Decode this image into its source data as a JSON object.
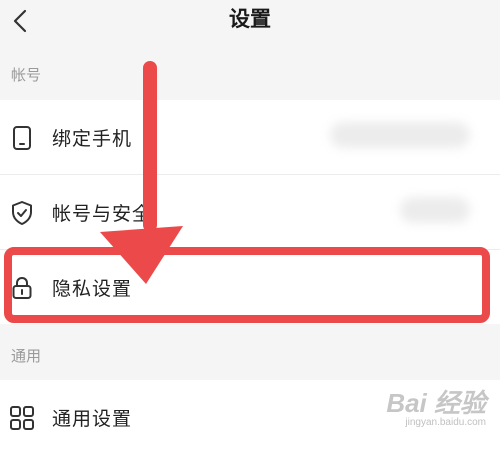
{
  "header": {
    "title": "设置",
    "back_icon": "chevron-left-icon"
  },
  "sections": {
    "account": {
      "label": "帐号",
      "items": [
        {
          "label": "绑定手机",
          "icon": "phone-icon"
        },
        {
          "label": "帐号与安全",
          "icon": "shield-check-icon"
        },
        {
          "label": "隐私设置",
          "icon": "lock-icon"
        }
      ]
    },
    "general": {
      "label": "通用",
      "items": [
        {
          "label": "通用设置",
          "icon": "grid-icon"
        }
      ]
    }
  },
  "annotation": {
    "color": "#ec4a4a",
    "target": "隐私设置"
  },
  "watermark": {
    "main": "Bai 经验",
    "sub": "jingyan.baidu.com"
  }
}
